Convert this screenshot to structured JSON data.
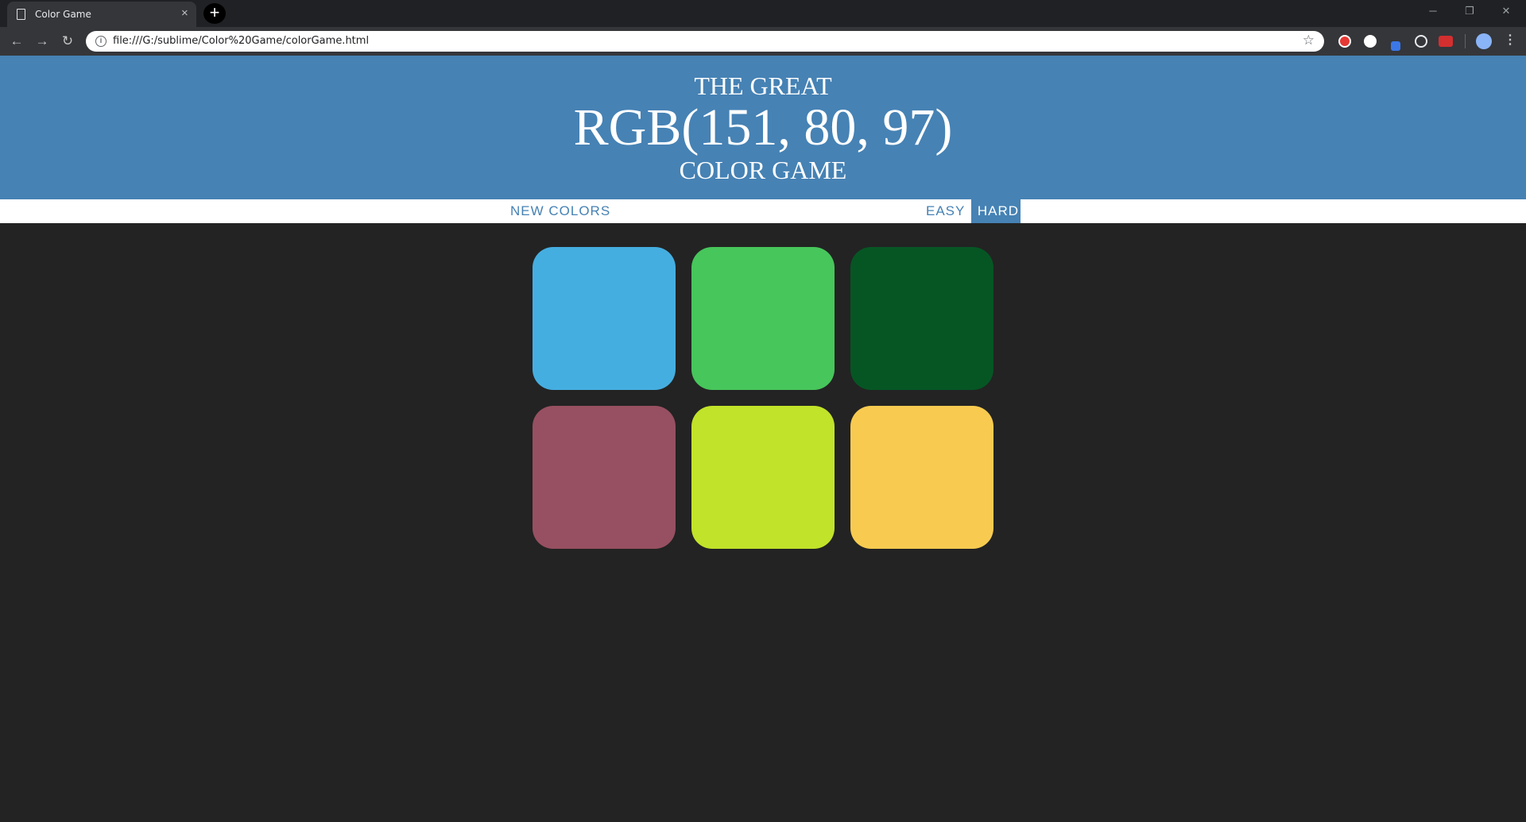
{
  "browser": {
    "tab_title": "Color Game",
    "tab_close": "×",
    "new_tab": "+",
    "url": "file:///G:/sublime/Color%20Game/colorGame.html",
    "window_controls": {
      "minimize": "─",
      "maximize": "❐",
      "close": "✕"
    },
    "nav": {
      "back": "←",
      "forward": "→",
      "reload": "↻",
      "bookmark": "☆",
      "menu": "⋮"
    }
  },
  "header": {
    "line1": "The Great",
    "rgb_display": "RGB(151, 80, 97)",
    "line3": "Color Game",
    "background": "#4682b4"
  },
  "stripe": {
    "reset_label": "New Colors",
    "easy_label": "Easy",
    "hard_label": "Hard",
    "selected_mode": "Hard"
  },
  "squares": [
    {
      "color": "#45aee0"
    },
    {
      "color": "#47c65b"
    },
    {
      "color": "#065624"
    },
    {
      "color": "#975061"
    },
    {
      "color": "#c1e329"
    },
    {
      "color": "#f8cb50"
    }
  ]
}
